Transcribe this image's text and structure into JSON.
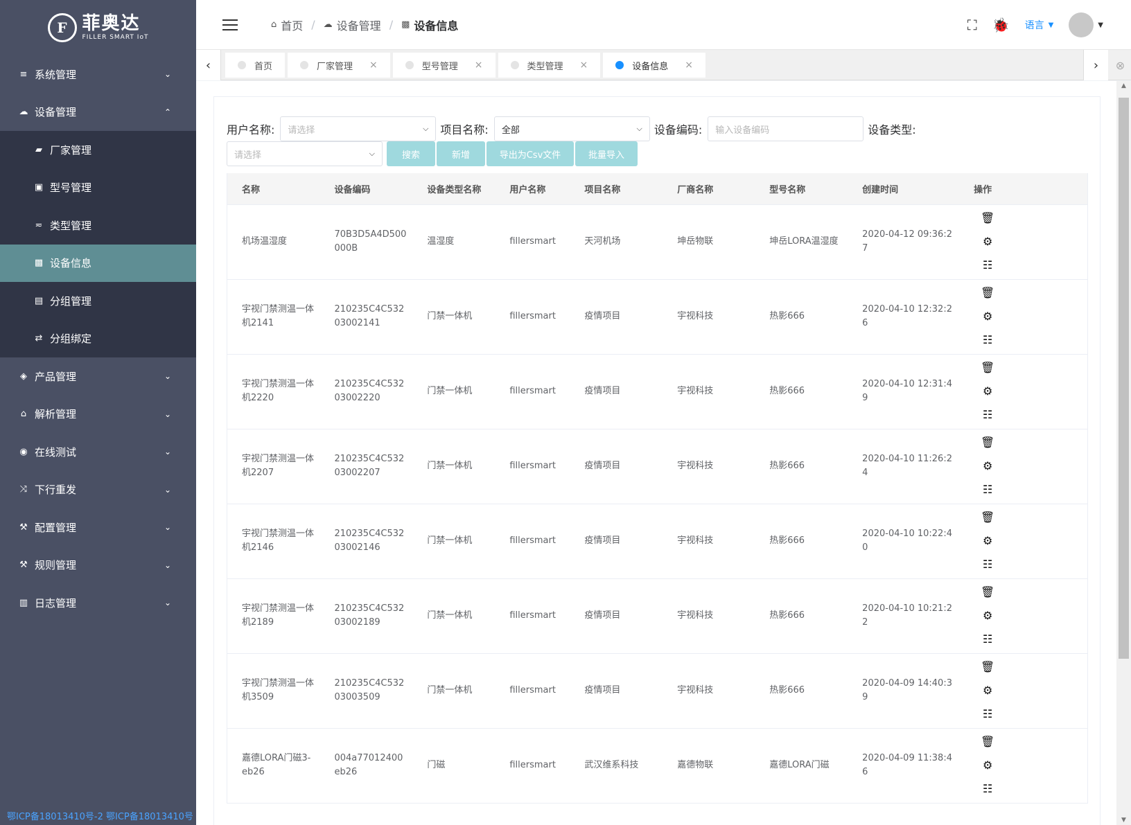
{
  "logo": {
    "mark": "F",
    "cn": "菲奥达",
    "en": "FILLER SMART IoT"
  },
  "sidebar": {
    "items": [
      {
        "label": "系统管理",
        "icon": "layers-icon",
        "glyph": "≡",
        "expanded": false
      },
      {
        "label": "设备管理",
        "icon": "cloud-upload-icon",
        "glyph": "☁",
        "expanded": true,
        "children": [
          {
            "label": "厂家管理",
            "icon": "briefcase-icon",
            "glyph": "▰"
          },
          {
            "label": "型号管理",
            "icon": "suitcase-icon",
            "glyph": "▣"
          },
          {
            "label": "类型管理",
            "icon": "filter-icon",
            "glyph": "≂"
          },
          {
            "label": "设备信息",
            "icon": "device-icon",
            "glyph": "▩",
            "active": true
          },
          {
            "label": "分组管理",
            "icon": "stack-icon",
            "glyph": "▤"
          },
          {
            "label": "分组绑定",
            "icon": "link-icon",
            "glyph": "⇄"
          }
        ]
      },
      {
        "label": "产品管理",
        "icon": "cube-icon",
        "glyph": "◈",
        "expanded": false
      },
      {
        "label": "解析管理",
        "icon": "home-icon",
        "glyph": "⌂",
        "expanded": false
      },
      {
        "label": "在线测试",
        "icon": "dashboard-icon",
        "glyph": "◉",
        "expanded": false
      },
      {
        "label": "下行重发",
        "icon": "shuffle-icon",
        "glyph": "⤨",
        "expanded": false
      },
      {
        "label": "配置管理",
        "icon": "hammer-icon",
        "glyph": "⚒",
        "expanded": false
      },
      {
        "label": "规则管理",
        "icon": "hammer-icon",
        "glyph": "⚒",
        "expanded": false
      },
      {
        "label": "日志管理",
        "icon": "bar-chart-icon",
        "glyph": "▥",
        "expanded": false
      }
    ],
    "icp": "鄂ICP备18013410号-2 鄂ICP备18013410号"
  },
  "header": {
    "breadcrumb": [
      {
        "label": "首页",
        "icon": "home-icon",
        "glyph": "⌂"
      },
      {
        "label": "设备管理",
        "icon": "cloud-icon",
        "glyph": "☁"
      },
      {
        "label": "设备信息",
        "icon": "device-icon",
        "glyph": "▩"
      }
    ],
    "language": "语言"
  },
  "tabs": [
    {
      "label": "首页",
      "closable": false,
      "active": false
    },
    {
      "label": "厂家管理",
      "closable": true,
      "active": false
    },
    {
      "label": "型号管理",
      "closable": true,
      "active": false
    },
    {
      "label": "类型管理",
      "closable": true,
      "active": false
    },
    {
      "label": "设备信息",
      "closable": true,
      "active": true
    }
  ],
  "filter": {
    "user_label": "用户名称:",
    "user_placeholder": "请选择",
    "project_label": "项目名称:",
    "project_value": "全部",
    "code_label": "设备编码:",
    "code_placeholder": "输入设备编码",
    "type_label": "设备类型:",
    "type_placeholder": "请选择",
    "buttons": [
      "搜索",
      "新增",
      "导出为Csv文件",
      "批量导入"
    ]
  },
  "table": {
    "columns": [
      "名称",
      "设备编码",
      "设备类型名称",
      "用户名称",
      "项目名称",
      "厂商名称",
      "型号名称",
      "创建时间",
      "操作"
    ],
    "rows": [
      [
        "机场温湿度",
        "70B3D5A4D500000B",
        "温湿度",
        "fillersmart",
        "天河机场",
        "坤岳物联",
        "坤岳LORA温湿度",
        "2020-04-12 09:36:27"
      ],
      [
        "宇视门禁测温一体机2141",
        "210235C4C53203002141",
        "门禁一体机",
        "fillersmart",
        "疫情项目",
        "宇视科技",
        "热影666",
        "2020-04-10 12:32:26"
      ],
      [
        "宇视门禁测温一体机2220",
        "210235C4C53203002220",
        "门禁一体机",
        "fillersmart",
        "疫情项目",
        "宇视科技",
        "热影666",
        "2020-04-10 12:31:49"
      ],
      [
        "宇视门禁测温一体机2207",
        "210235C4C53203002207",
        "门禁一体机",
        "fillersmart",
        "疫情项目",
        "宇视科技",
        "热影666",
        "2020-04-10 11:26:24"
      ],
      [
        "宇视门禁测温一体机2146",
        "210235C4C53203002146",
        "门禁一体机",
        "fillersmart",
        "疫情项目",
        "宇视科技",
        "热影666",
        "2020-04-10 10:22:40"
      ],
      [
        "宇视门禁测温一体机2189",
        "210235C4C53203002189",
        "门禁一体机",
        "fillersmart",
        "疫情项目",
        "宇视科技",
        "热影666",
        "2020-04-10 10:21:22"
      ],
      [
        "宇视门禁测温一体机3509",
        "210235C4C53203003509",
        "门禁一体机",
        "fillersmart",
        "疫情项目",
        "宇视科技",
        "热影666",
        "2020-04-09 14:40:39"
      ],
      [
        "嘉德LORA门磁3-eb26",
        "004a77012400eb26",
        "门磁",
        "fillersmart",
        "武汉维系科技",
        "嘉德物联",
        "嘉德LORA门磁",
        "2020-04-09 11:38:46"
      ]
    ],
    "row_actions": [
      {
        "icon": "trash-icon",
        "glyph": "🗑"
      },
      {
        "icon": "gear-icon",
        "glyph": "⚙"
      },
      {
        "icon": "list-detail-icon",
        "glyph": "☷"
      }
    ]
  }
}
